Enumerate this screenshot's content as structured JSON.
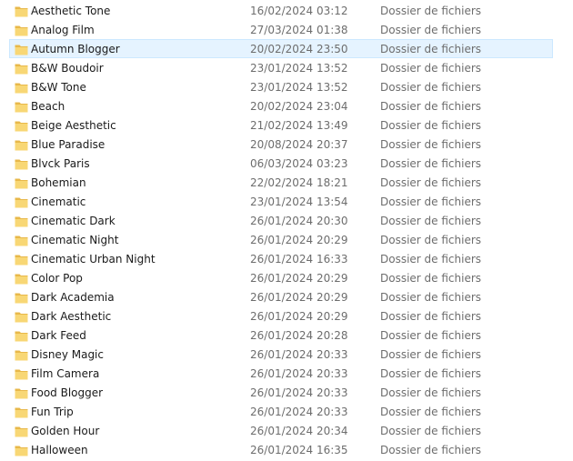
{
  "files": [
    {
      "name": "Aesthetic Tone",
      "date": "16/02/2024 03:12",
      "type": "Dossier de fichiers",
      "selected": false
    },
    {
      "name": "Analog Film",
      "date": "27/03/2024 01:38",
      "type": "Dossier de fichiers",
      "selected": false
    },
    {
      "name": "Autumn Blogger",
      "date": "20/02/2024 23:50",
      "type": "Dossier de fichiers",
      "selected": true
    },
    {
      "name": "B&W Boudoir",
      "date": "23/01/2024 13:52",
      "type": "Dossier de fichiers",
      "selected": false
    },
    {
      "name": "B&W Tone",
      "date": "23/01/2024 13:52",
      "type": "Dossier de fichiers",
      "selected": false
    },
    {
      "name": "Beach",
      "date": "20/02/2024 23:04",
      "type": "Dossier de fichiers",
      "selected": false
    },
    {
      "name": "Beige Aesthetic",
      "date": "21/02/2024 13:49",
      "type": "Dossier de fichiers",
      "selected": false
    },
    {
      "name": "Blue Paradise",
      "date": "20/08/2024 20:37",
      "type": "Dossier de fichiers",
      "selected": false
    },
    {
      "name": "Blvck Paris",
      "date": "06/03/2024 03:23",
      "type": "Dossier de fichiers",
      "selected": false
    },
    {
      "name": "Bohemian",
      "date": "22/02/2024 18:21",
      "type": "Dossier de fichiers",
      "selected": false
    },
    {
      "name": "Cinematic",
      "date": "23/01/2024 13:54",
      "type": "Dossier de fichiers",
      "selected": false
    },
    {
      "name": "Cinematic Dark",
      "date": "26/01/2024 20:30",
      "type": "Dossier de fichiers",
      "selected": false
    },
    {
      "name": "Cinematic Night",
      "date": "26/01/2024 20:29",
      "type": "Dossier de fichiers",
      "selected": false
    },
    {
      "name": "Cinematic Urban Night",
      "date": "26/01/2024 16:33",
      "type": "Dossier de fichiers",
      "selected": false
    },
    {
      "name": "Color Pop",
      "date": "26/01/2024 20:29",
      "type": "Dossier de fichiers",
      "selected": false
    },
    {
      "name": "Dark Academia",
      "date": "26/01/2024 20:29",
      "type": "Dossier de fichiers",
      "selected": false
    },
    {
      "name": "Dark Aesthetic",
      "date": "26/01/2024 20:29",
      "type": "Dossier de fichiers",
      "selected": false
    },
    {
      "name": "Dark Feed",
      "date": "26/01/2024 20:28",
      "type": "Dossier de fichiers",
      "selected": false
    },
    {
      "name": "Disney Magic",
      "date": "26/01/2024 20:33",
      "type": "Dossier de fichiers",
      "selected": false
    },
    {
      "name": "Film Camera",
      "date": "26/01/2024 20:33",
      "type": "Dossier de fichiers",
      "selected": false
    },
    {
      "name": "Food Blogger",
      "date": "26/01/2024 20:33",
      "type": "Dossier de fichiers",
      "selected": false
    },
    {
      "name": "Fun Trip",
      "date": "26/01/2024 20:33",
      "type": "Dossier de fichiers",
      "selected": false
    },
    {
      "name": "Golden Hour",
      "date": "26/01/2024 20:34",
      "type": "Dossier de fichiers",
      "selected": false
    },
    {
      "name": "Halloween",
      "date": "26/01/2024 16:35",
      "type": "Dossier de fichiers",
      "selected": false
    }
  ],
  "icon": "folder-icon",
  "colors": {
    "selection_background": "#e5f3ff",
    "selection_border": "#cce8ff",
    "folder_yellow": "#f8d775",
    "folder_dark_yellow": "#e8b84a",
    "secondary_text": "#6d6d6d"
  }
}
